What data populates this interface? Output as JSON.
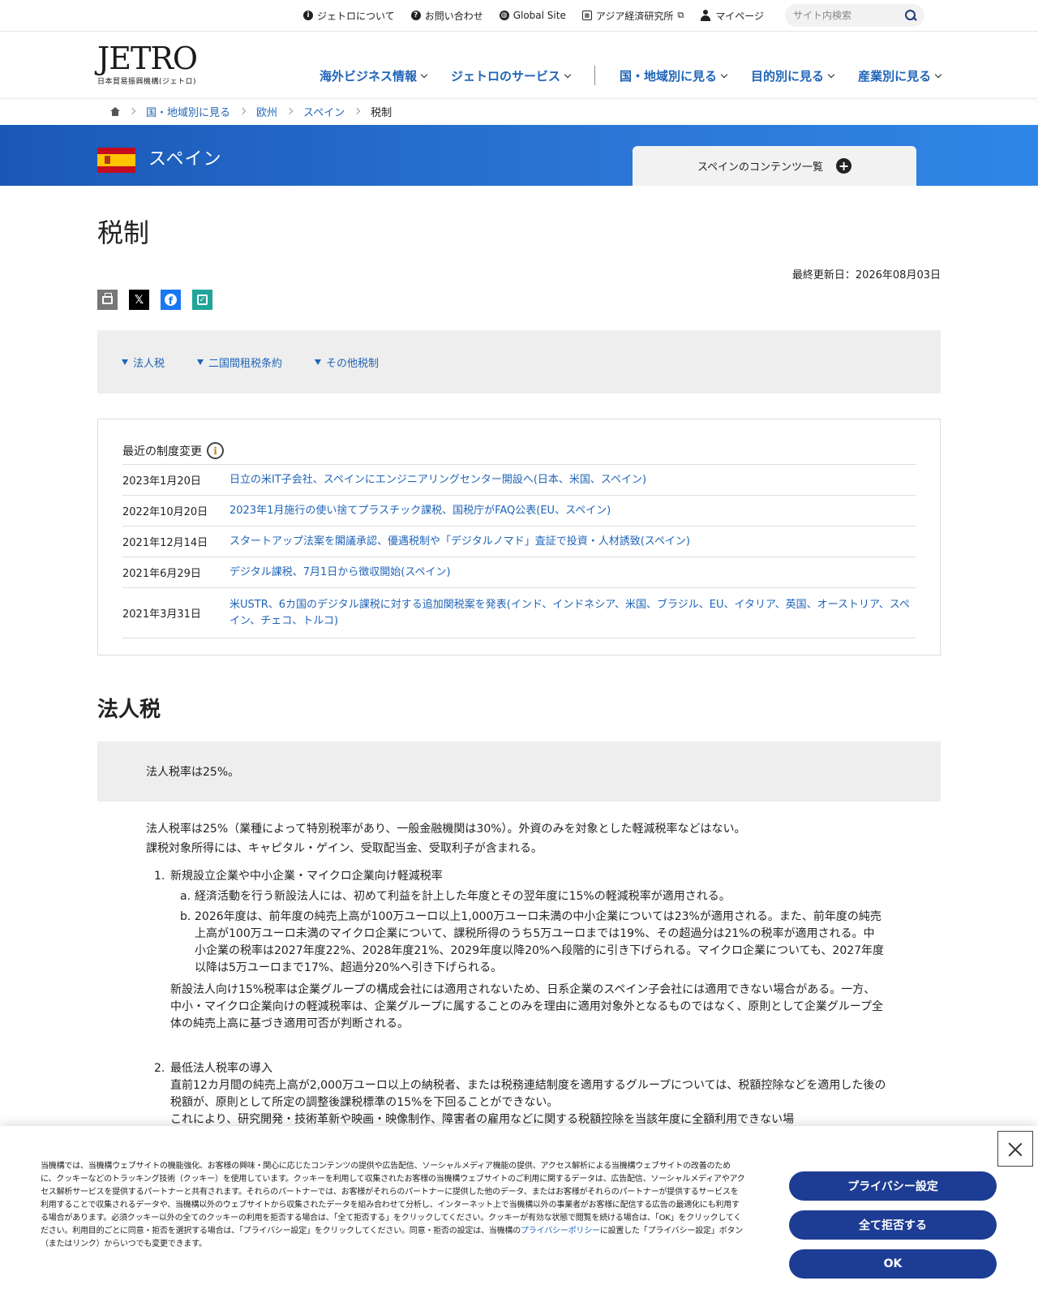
{
  "utility": {
    "about": "ジェトロについて",
    "contact": "お問い合わせ",
    "global": "Global Site",
    "ide": "アジア経済研究所",
    "mypage": "マイページ",
    "search_placeholder": "サイト内検索"
  },
  "logo": {
    "word": "JETRO",
    "sub": "日本貿易振興機構(ジェトロ)"
  },
  "gnav": [
    "海外ビジネス情報",
    "ジェトロのサービス",
    "国・地域別に見る",
    "目的別に見る",
    "産業別に見る"
  ],
  "breadcrumb": [
    "国・地域別に見る",
    "欧州",
    "スペイン",
    "税制"
  ],
  "banner": {
    "country": "スペイン",
    "content_tab": "スペインのコンテンツ一覧"
  },
  "page": {
    "title": "税制",
    "updated": "最終更新日：2026年08月03日"
  },
  "anchors": [
    "法人税",
    "二国間租税条約",
    "その他税制"
  ],
  "changes": {
    "heading": "最近の制度変更",
    "rows": [
      {
        "date": "2023年1月20日",
        "text": "日立の米IT子会社、スペインにエンジニアリングセンター開設へ(日本、米国、スペイン)"
      },
      {
        "date": "2022年10月20日",
        "text": "2023年1月施行の使い捨てプラスチック課税、国税庁がFAQ公表(EU、スペイン)"
      },
      {
        "date": "2021年12月14日",
        "text": "スタートアップ法案を閣議承認、優遇税制や「デジタルノマド」査証で投資・人材誘致(スペイン)"
      },
      {
        "date": "2021年6月29日",
        "text": "デジタル課税、7月1日から徴収開始(スペイン)"
      },
      {
        "date": "2021年3月31日",
        "text": "米USTR、6カ国のデジタル課税に対する追加関税案を発表(インド、インドネシア、米国、ブラジル、EU、イタリア、英国、オーストリア、スペイン、チェコ、トルコ)"
      }
    ]
  },
  "section": {
    "title": "法人税",
    "summary": "法人税率は25%。",
    "para1": "法人税率は25%（業種によって特別税率があり、一般金融機関は30%）。外資のみを対象とした軽減税率などはない。",
    "para2": "課税対象所得には、キャピタル・ゲイン、受取配当金、受取利子が含まれる。",
    "item1": {
      "num": "1.",
      "head": "新規設立企業や中小企業・マイクロ企業向け軽減税率",
      "a_label": "a.",
      "a": "経済活動を行う新設法人には、初めて利益を計上した年度とその翌年度に15%の軽減税率が適用される。",
      "b_label": "b.",
      "b": "2026年度は、前年度の純売上高が100万ユーロ以上1,000万ユーロ未満の中小企業については23%が適用される。また、前年度の純売上高が100万ユーロ未満のマイクロ企業について、課税所得のうち5万ユーロまでは19%、その超過分は21%の税率が適用される。中小企業の税率は2027年度22%、2028年度21%、2029年度以降20%へ段階的に引き下げられる。マイクロ企業についても、2027年度以降は5万ユーロまで17%、超過分20%へ引き下げられる。",
      "note": "新設法人向け15%税率は企業グループの構成会社には適用されないため、日系企業のスペイン子会社には適用できない場合がある。一方、中小・マイクロ企業向けの軽減税率は、企業グループに属することのみを理由に適用対象外となるものではなく、原則として企業グループ全体の純売上高に基づき適用可否が判断される。"
    },
    "item2": {
      "num": "2.",
      "head": "最低法人税率の導入",
      "p1": "直前12カ月間の純売上高が2,000万ユーロ以上の納税者、または税務連結制度を適用するグループについては、税額控除などを適用した後の税額が、原則として所定の調整後課税標準の15%を下回ることができない。",
      "p2": "これにより、研究開発・技術革新や映画・映像制作、障害者の雇用などに関する税額控除を当該年度に全額利用できない場"
    }
  },
  "cookie": {
    "text_before": "当機構では、当機構ウェブサイトの機能強化、お客様の興味・関心に応じたコンテンツの提供や広告配信、ソーシャルメディア機能の提供、アクセス解析による当機構ウェブサイトの改善のために、クッキーなどのトラッキング技術（クッキー）を使用しています。クッキーを利用して収集されたお客様の当機構ウェブサイトのご利用に関するデータは、広告配信、ソーシャルメディアやアクセス解析サービスを提供するパートナーと共有されます。それらのパートナーでは、お客様がそれらのパートナーに提供した他のデータ、またはお客様がそれらのパートナーが提供するサービスを利用することで収集されるデータや、当機構以外のウェブサイトから収集されたデータを組み合わせて分析し、インターネット上で当機構以外の事業者がお客様に配信する広告の最適化にも利用する場合があります。必須クッキー以外の全てのクッキーの利用を拒否する場合は、「全て拒否する」をクリックしてください。クッキーが有効な状態で閲覧を続ける場合は、「OK」をクリックしてください。利用目的ごとに同意・拒否を選択する場合は、「プライバシー設定」をクリックしてください。同意・拒否の設定は、当機構の",
    "link": "プライバシーポリシー",
    "text_after": "に設置した「プライバシー設定」ボタン（またはリンク）からいつでも変更できます。",
    "btn_privacy": "プライバシー設定",
    "btn_reject": "全て拒否する",
    "btn_ok": "OK"
  }
}
